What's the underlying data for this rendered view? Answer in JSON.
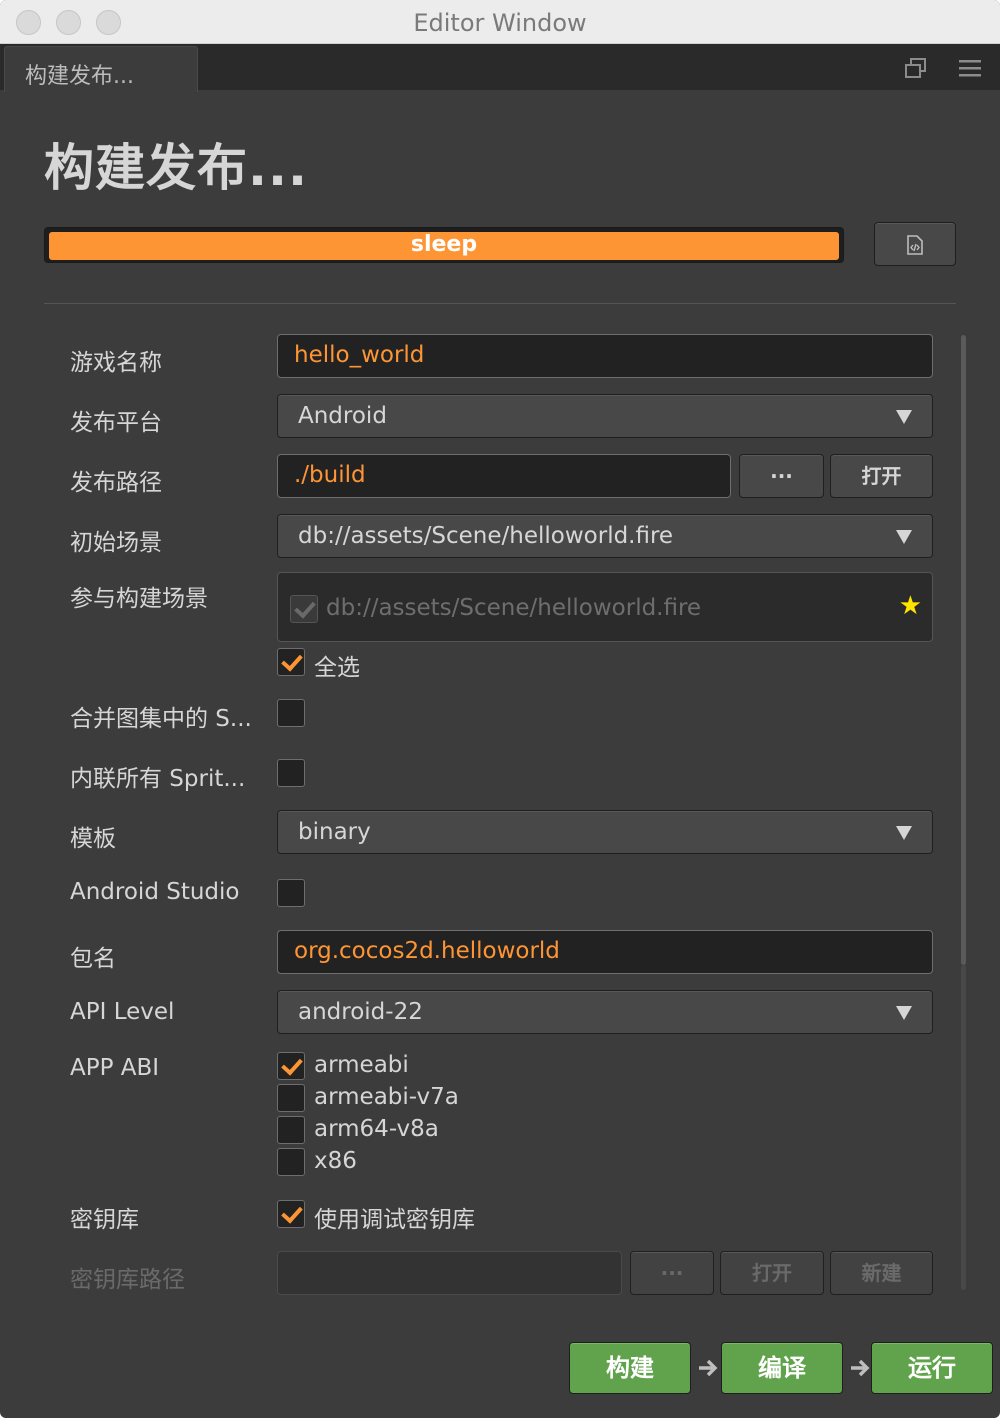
{
  "window": {
    "title": "Editor Window"
  },
  "tab": {
    "label": "构建发布..."
  },
  "page": {
    "title": "构建发布..."
  },
  "progress": {
    "label": "sleep",
    "percent": 100,
    "color": "#fe9535"
  },
  "form": {
    "game_name": {
      "label": "游戏名称",
      "value": "hello_world"
    },
    "platform": {
      "label": "发布平台",
      "value": "Android"
    },
    "build_path": {
      "label": "发布路径",
      "value": "./build",
      "browse_label": "···",
      "open_label": "打开"
    },
    "start_scene": {
      "label": "初始场景",
      "value": "db://assets/Scene/helloworld.fire"
    },
    "included_scenes": {
      "label": "参与构建场景",
      "items": [
        {
          "path": "db://assets/Scene/helloworld.fire",
          "checked": true,
          "is_start": true
        }
      ],
      "select_all_label": "全选",
      "select_all_checked": true
    },
    "merge_spriteframes": {
      "label": "合并图集中的 S...",
      "checked": false
    },
    "inline_spriteframes": {
      "label": "内联所有 Sprit...",
      "checked": false
    },
    "template": {
      "label": "模板",
      "value": "binary"
    },
    "android_studio": {
      "label": "Android Studio",
      "checked": false
    },
    "package_name": {
      "label": "包名",
      "value": "org.cocos2d.helloworld"
    },
    "api_level": {
      "label": "API Level",
      "value": "android-22"
    },
    "app_abi": {
      "label": "APP ABI",
      "options": [
        {
          "name": "armeabi",
          "checked": true
        },
        {
          "name": "armeabi-v7a",
          "checked": false
        },
        {
          "name": "arm64-v8a",
          "checked": false
        },
        {
          "name": "x86",
          "checked": false
        }
      ]
    },
    "keystore": {
      "label": "密钥库",
      "option_label": "使用调试密钥库",
      "checked": true
    },
    "keystore_path": {
      "label": "密钥库路径",
      "value": "",
      "browse_label": "···",
      "open_label": "打开",
      "new_label": "新建"
    }
  },
  "actions": {
    "build": "构建",
    "compile": "编译",
    "run": "运行"
  },
  "icons": {
    "restore": "restore-window-icon",
    "menu": "hamburger-menu-icon",
    "json": "json-file-icon",
    "star": "star-icon",
    "arrow": "right-arrow-icon"
  }
}
